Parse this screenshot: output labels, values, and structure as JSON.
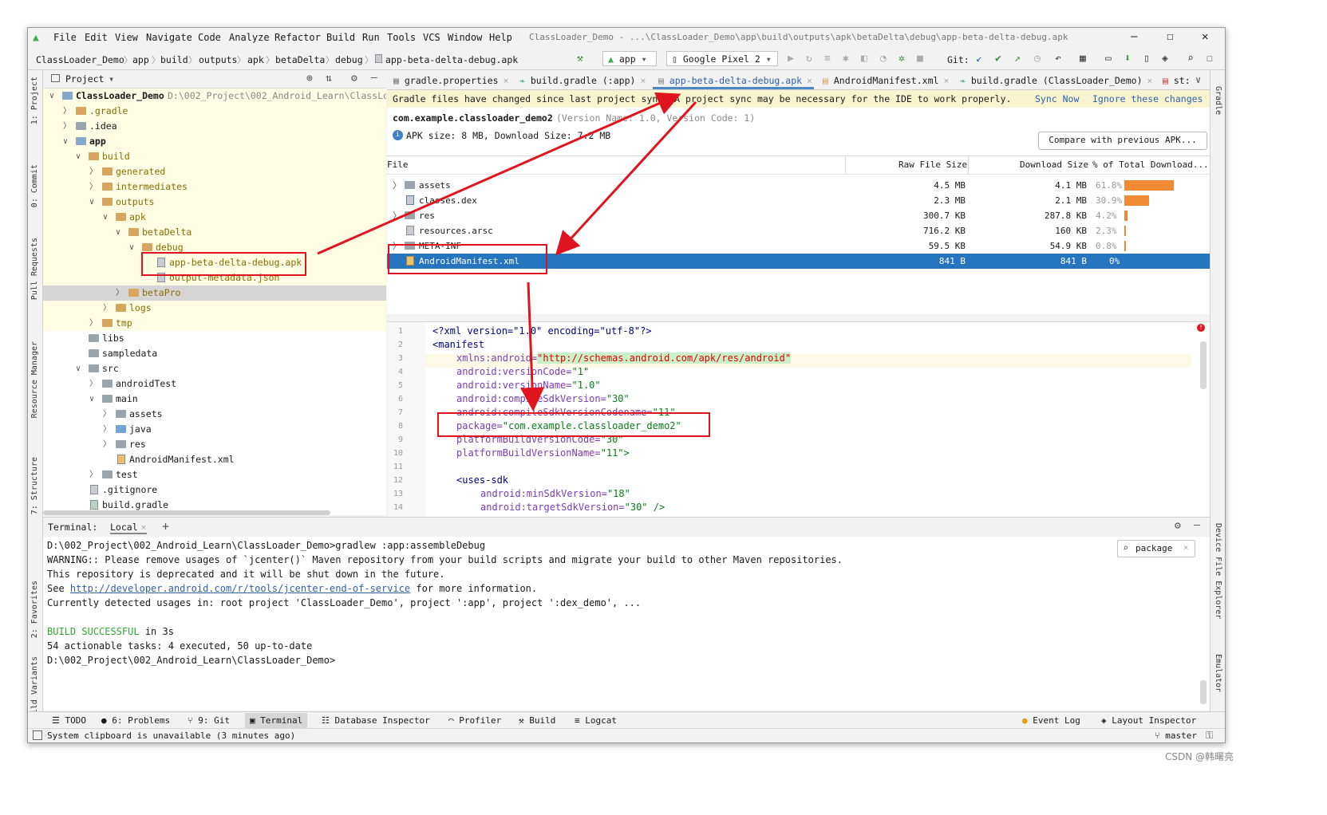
{
  "window": {
    "title": "ClassLoader_Demo - ...\\ClassLoader_Demo\\app\\build\\outputs\\apk\\betaDelta\\debug\\app-beta-delta-debug.apk",
    "menu": [
      "File",
      "Edit",
      "View",
      "Navigate",
      "Code",
      "Analyze",
      "Refactor",
      "Build",
      "Run",
      "Tools",
      "VCS",
      "Window",
      "Help"
    ]
  },
  "breadcrumb": [
    "ClassLoader_Demo",
    "app",
    "build",
    "outputs",
    "apk",
    "betaDelta",
    "debug",
    "app-beta-delta-debug.apk"
  ],
  "toolbar": {
    "run_config": "app",
    "device": "Google Pixel 2",
    "git_label": "Git:"
  },
  "left_strip": [
    "1: Project",
    "0: Commit",
    "Pull Requests",
    "Resource Manager",
    "7: Structure",
    "2: Favorites",
    "Build Variants"
  ],
  "right_strip": [
    "Gradle",
    "Device File Explorer",
    "Emulator"
  ],
  "project": {
    "header": "Project",
    "root_name": "ClassLoader_Demo",
    "root_path": "D:\\002_Project\\002_Android_Learn\\ClassLoader_Demo",
    "tree": [
      ".gradle",
      ".idea",
      "app",
      "build",
      "generated",
      "intermediates",
      "outputs",
      "apk",
      "betaDelta",
      "debug",
      "app-beta-delta-debug.apk",
      "output-metadata.json",
      "betaPro",
      "logs",
      "tmp",
      "libs",
      "sampledata",
      "src",
      "androidTest",
      "main",
      "assets",
      "java",
      "res",
      "AndroidManifest.xml",
      "test",
      ".gitignore",
      "build.gradle"
    ]
  },
  "tabs": [
    "gradle.properties",
    "build.gradle (:app)",
    "app-beta-delta-debug.apk",
    "AndroidManifest.xml",
    "build.gradle (ClassLoader_Demo)",
    "st:"
  ],
  "banner": {
    "message": "Gradle files have changed since last project sync. A project sync may be necessary for the IDE to work properly.",
    "sync_now": "Sync Now",
    "ignore": "Ignore these changes"
  },
  "apk": {
    "package": "com.example.classloader_demo2",
    "version_text": "(Version Name: 1.0, Version Code: 1)",
    "size_text": "APK size: 8 MB, Download Size: 7.2 MB",
    "compare_button": "Compare with previous APK...",
    "columns": [
      "File",
      "Raw File Size",
      "Download Size",
      "% of Total Download..."
    ],
    "rows": [
      {
        "name": "assets",
        "raw": "4.5 MB",
        "download": "4.1 MB",
        "pct": "61.8%",
        "pct_value": 61.8
      },
      {
        "name": "classes.dex",
        "raw": "2.3 MB",
        "download": "2.1 MB",
        "pct": "30.9%",
        "pct_value": 30.9
      },
      {
        "name": "res",
        "raw": "300.7 KB",
        "download": "287.8 KB",
        "pct": "4.2%",
        "pct_value": 4.2
      },
      {
        "name": "resources.arsc",
        "raw": "716.2 KB",
        "download": "160 KB",
        "pct": "2.3%",
        "pct_value": 2.3
      },
      {
        "name": "META-INF",
        "raw": "59.5 KB",
        "download": "54.9 KB",
        "pct": "0.8%",
        "pct_value": 0.8
      },
      {
        "name": "AndroidManifest.xml",
        "raw": "841 B",
        "download": "841 B",
        "pct": "0%",
        "pct_value": 0
      }
    ]
  },
  "xml": {
    "line_numbers": [
      "1",
      "2",
      "3",
      "4",
      "5",
      "6",
      "7",
      "8",
      "9",
      "10",
      "11",
      "12",
      "13",
      "14"
    ],
    "l1": "<?xml version=\"1.0\" encoding=\"utf-8\"?>",
    "l2": "<manifest",
    "l3_attr": "xmlns:android=",
    "l3_val": "\"http://schemas.android.com/apk/res/android\"",
    "l4_attr": "android:versionCode=",
    "l4_val": "\"1\"",
    "l5_attr": "android:versionName=",
    "l5_val": "\"1.0\"",
    "l6_attr": "android:compileSdkVersion=",
    "l6_val": "\"30\"",
    "l7_attr": "android:compileSdkVersionCodename=",
    "l7_val": "\"11\"",
    "l8_attr": "package=",
    "l8_val": "\"com.example.classloader_demo2\"",
    "l9_attr": "platformBuildVersionCode=",
    "l9_val": "\"30\"",
    "l10_attr": "platformBuildVersionName=",
    "l10_val": "\"11\">",
    "l12": "<uses-sdk",
    "l13_attr": "android:minSdkVersion=",
    "l13_val": "\"18\"",
    "l14_attr": "android:targetSdkVersion=",
    "l14_val": "\"30\" />"
  },
  "terminal": {
    "label": "Terminal:",
    "tab": "Local",
    "search_value": "package",
    "line1": "D:\\002_Project\\002_Android_Learn\\ClassLoader_Demo>gradlew :app:assembleDebug",
    "line2": "WARNING:: Please remove usages of `jcenter()` Maven repository from your build scripts and migrate your build to other Maven repositories.",
    "line3": "This repository is deprecated and it will be shut down in the future.",
    "line4_pre": "See ",
    "line4_link": "http://developer.android.com/r/tools/jcenter-end-of-service",
    "line4_post": " for more information.",
    "line5": "Currently detected usages in: root project 'ClassLoader_Demo', project ':app', project ':dex_demo', ...",
    "line7_green": "BUILD SUCCESSFUL",
    "line7_rest": " in 3s",
    "line8": "54 actionable tasks: 4 executed, 50 up-to-date",
    "line9": "D:\\002_Project\\002_Android_Learn\\ClassLoader_Demo>"
  },
  "tool_windows": [
    "TODO",
    "6: Problems",
    "9: Git",
    "Terminal",
    "Database Inspector",
    "Profiler",
    "Build",
    "Logcat"
  ],
  "tool_windows_right": [
    "Event Log",
    "Layout Inspector"
  ],
  "status": {
    "message": "System clipboard is unavailable (3 minutes ago)",
    "branch": "master"
  },
  "watermark": "CSDN @韩曙亮",
  "colors": {
    "selection": "#2675bf",
    "annotation": "#e0141e",
    "bar": "#f08a34",
    "banner": "#f8f4cf"
  }
}
